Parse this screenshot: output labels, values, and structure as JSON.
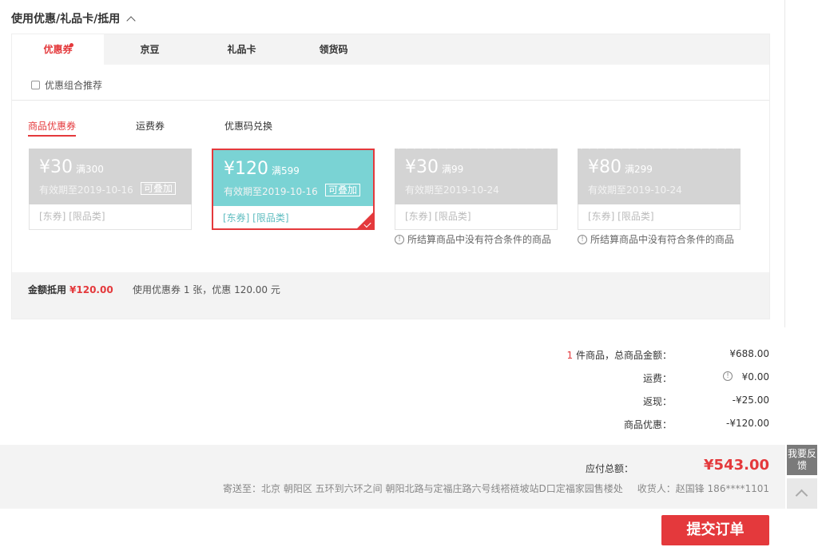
{
  "section": {
    "title": "使用优惠/礼品卡/抵用"
  },
  "tabs": [
    {
      "label": "优惠券"
    },
    {
      "label": "京豆"
    },
    {
      "label": "礼品卡"
    },
    {
      "label": "领货码"
    }
  ],
  "combo_label": "优惠组合推荐",
  "subtabs": [
    {
      "label": "商品优惠券"
    },
    {
      "label": "运费券"
    },
    {
      "label": "优惠码兑换"
    }
  ],
  "coupons": [
    {
      "price": "¥30",
      "cond": "满300",
      "expiry": "有效期至2019-10-16",
      "stack": "可叠加",
      "tags": "[东券]  [限品类]"
    },
    {
      "price": "¥120",
      "cond": "满599",
      "expiry": "有效期至2019-10-16",
      "stack": "可叠加",
      "tags": "[东券]  [限品类]"
    },
    {
      "price": "¥30",
      "cond": "满99",
      "expiry": "有效期至2019-10-24",
      "tags": "[东券]  [限品类]",
      "note": "所结算商品中没有符合条件的商品"
    },
    {
      "price": "¥80",
      "cond": "满299",
      "expiry": "有效期至2019-10-24",
      "tags": "[东券]  [限品类]",
      "note": "所结算商品中没有符合条件的商品"
    }
  ],
  "summary": {
    "label": "金额抵用",
    "amount": "¥120.00",
    "desc": "使用优惠券 1 张，优惠 120.00 元"
  },
  "totals": {
    "count": "1",
    "items_label": " 件商品，总商品金额：",
    "items_value": "¥688.00",
    "shipping_label": "运费：",
    "shipping_value": "¥0.00",
    "cashback_label": "返现：",
    "cashback_value": "-¥25.00",
    "discount_label": "商品优惠：",
    "discount_value": "-¥120.00"
  },
  "payable": {
    "label": "应付总额：",
    "amount": "¥543.00",
    "address": "寄送至：北京 朝阳区 五环到六环之间 朝阳北路与定福庄路六号线褡裢坡站D口定福家园售楼处",
    "receiver": "收货人：赵国锋 186****1101"
  },
  "submit_label": "提交订单",
  "side": {
    "feedback": "我要反馈"
  },
  "colors": {
    "accent": "#e4393c",
    "selected_coupon": "#7ad3d4",
    "disabled_coupon": "#d4d4d4"
  }
}
